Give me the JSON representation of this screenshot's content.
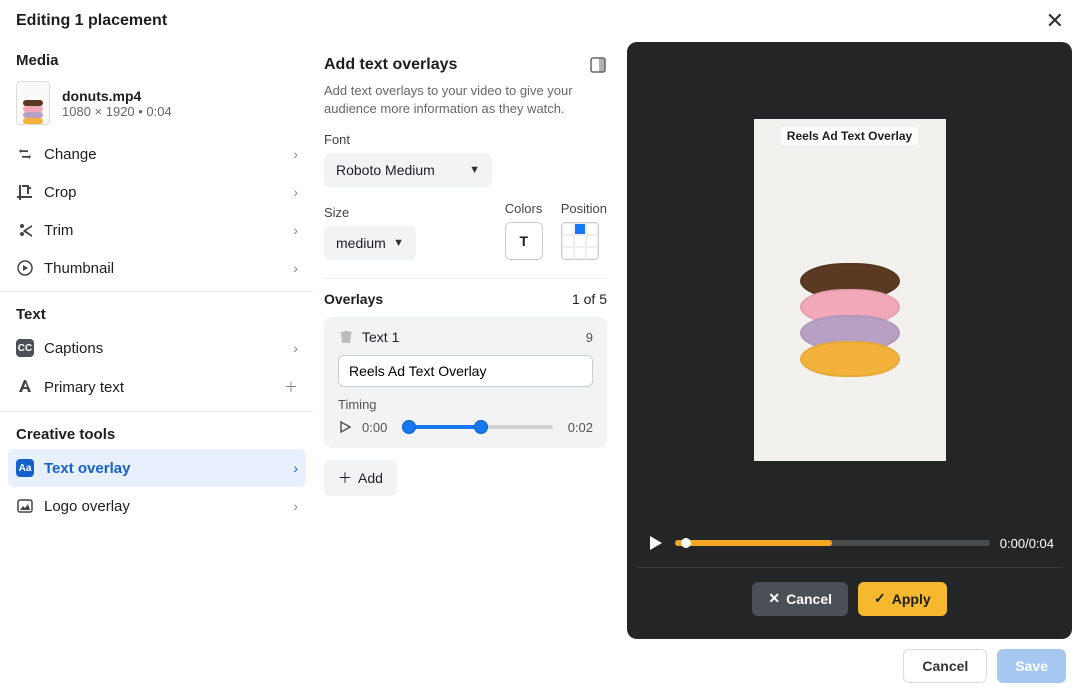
{
  "header": {
    "title": "Editing 1 placement"
  },
  "media": {
    "section": "Media",
    "filename": "donuts.mp4",
    "dimensions": "1080 × 1920 • 0:04",
    "items": [
      {
        "label": "Change"
      },
      {
        "label": "Crop"
      },
      {
        "label": "Trim"
      },
      {
        "label": "Thumbnail"
      }
    ]
  },
  "text": {
    "section": "Text",
    "captions": "Captions",
    "primary": "Primary text"
  },
  "tools": {
    "section": "Creative tools",
    "text_overlay": "Text overlay",
    "logo_overlay": "Logo overlay"
  },
  "center": {
    "title": "Add text overlays",
    "desc": "Add text overlays to your video to give your audience more information as they watch.",
    "font_label": "Font",
    "font_value": "Roboto Medium",
    "size_label": "Size",
    "size_value": "medium",
    "colors_label": "Colors",
    "position_label": "Position",
    "overlays_label": "Overlays",
    "overlays_count": "1 of 5",
    "item": {
      "name": "Text 1",
      "length": "9",
      "value": "Reels Ad Text Overlay",
      "timing_label": "Timing",
      "start": "0:00",
      "end": "0:02"
    },
    "add": "Add"
  },
  "preview": {
    "overlay_text": "Reels Ad Text Overlay",
    "time_current": "0:00",
    "time_total": "0:04",
    "progress": 0.5,
    "cancel": "Cancel",
    "apply": "Apply"
  },
  "footer": {
    "cancel": "Cancel",
    "save": "Save"
  },
  "colors": {
    "donut1": "#5a3a22",
    "donut2": "#f1a8b8",
    "donut3": "#b7a0c4",
    "donut4": "#f3b23c"
  }
}
